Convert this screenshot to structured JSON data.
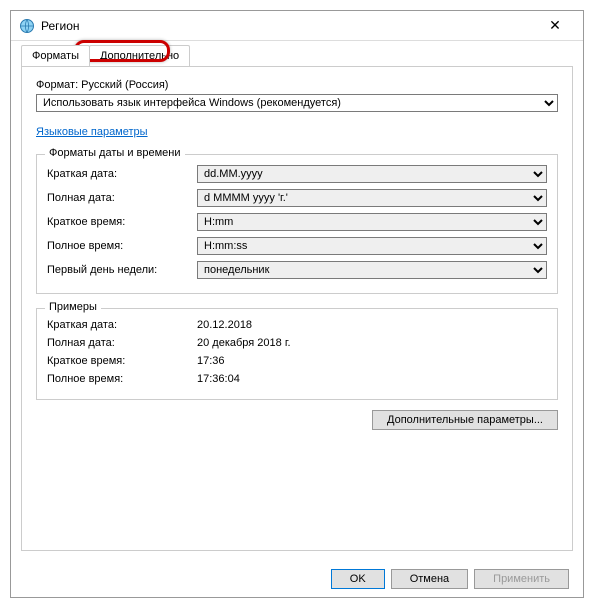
{
  "window": {
    "title": "Регион"
  },
  "tabs": {
    "formats": "Форматы",
    "additional": "Дополнительно"
  },
  "format": {
    "label": "Формат: Русский (Россия)",
    "value": "Использовать язык интерфейса Windows (рекомендуется)"
  },
  "link": "Языковые параметры",
  "dtgroup": {
    "legend": "Форматы даты и времени",
    "short_date_label": "Краткая дата:",
    "short_date_value": "dd.MM.yyyy",
    "long_date_label": "Полная дата:",
    "long_date_value": "d MMMM yyyy 'г.'",
    "short_time_label": "Краткое время:",
    "short_time_value": "H:mm",
    "long_time_label": "Полное время:",
    "long_time_value": "H:mm:ss",
    "first_day_label": "Первый день недели:",
    "first_day_value": "понедельник"
  },
  "examples": {
    "legend": "Примеры",
    "short_date_label": "Краткая дата:",
    "short_date_value": "20.12.2018",
    "long_date_label": "Полная дата:",
    "long_date_value": "20 декабря 2018 г.",
    "short_time_label": "Краткое время:",
    "short_time_value": "17:36",
    "long_time_label": "Полное время:",
    "long_time_value": "17:36:04"
  },
  "buttons": {
    "additional_params": "Дополнительные параметры...",
    "ok": "OK",
    "cancel": "Отмена",
    "apply": "Применить"
  }
}
